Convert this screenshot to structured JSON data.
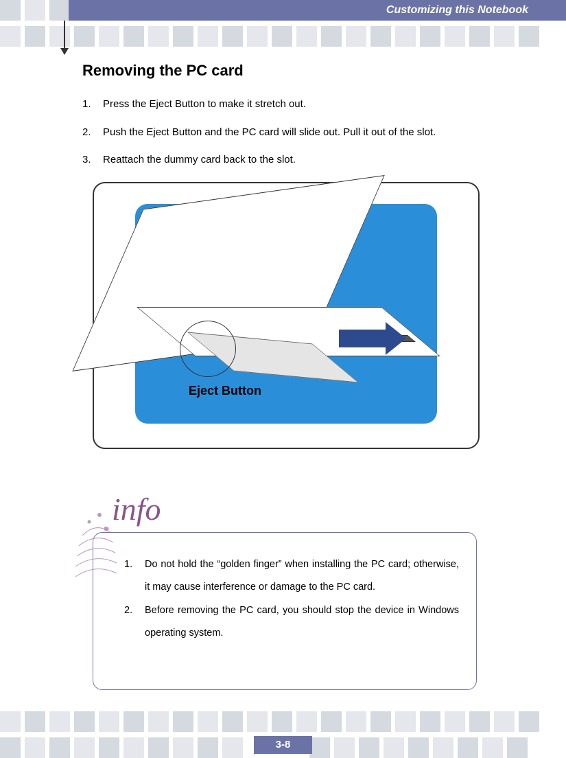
{
  "header": {
    "chapter_title": "Customizing this Notebook"
  },
  "section": {
    "heading": "Removing the PC card",
    "steps": [
      {
        "n": "1.",
        "text": "Press the Eject Button to make it stretch out."
      },
      {
        "n": "2.",
        "text": "Push the Eject Button and the PC card will slide out.   Pull it out of the slot."
      },
      {
        "n": "3.",
        "text": "Reattach the dummy card back to the slot."
      }
    ]
  },
  "figure": {
    "callout": "Eject Button"
  },
  "info": {
    "label": "info",
    "items": [
      {
        "n": "1.",
        "text": "Do not hold the “golden finger” when installing the PC card; otherwise, it may cause interference or damage to the PC card."
      },
      {
        "n": "2.",
        "text": "Before removing the PC card, you should stop the device in Windows operating system."
      }
    ]
  },
  "page_number": "3-8"
}
